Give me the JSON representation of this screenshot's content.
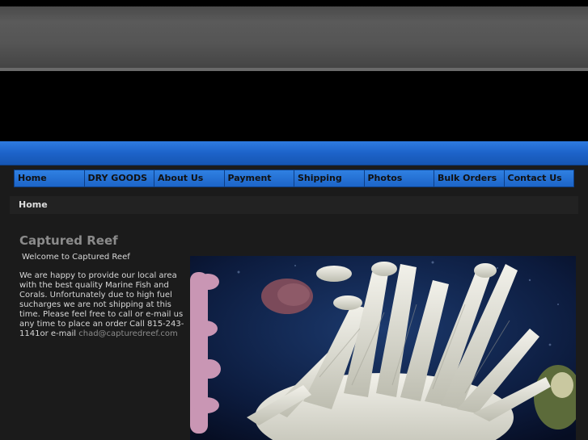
{
  "nav": {
    "items": [
      {
        "label": "Home"
      },
      {
        "label": "DRY GOODS"
      },
      {
        "label": "About Us"
      },
      {
        "label": "Payment"
      },
      {
        "label": "Shipping"
      },
      {
        "label": "Photos"
      },
      {
        "label": "Bulk Orders"
      },
      {
        "label": "Contact Us"
      }
    ]
  },
  "breadcrumb": "Home",
  "main": {
    "title": "Captured Reef",
    "welcome": "Welcome to Captured Reef",
    "body": "We are happy to provide our local area with the best quality Marine Fish and Corals. Unfortunately due to high fuel sucharges we are not shipping at this time. Please feel free to call or e-mail us any time to place an order Call 815-243-1141or e-mail",
    "email": "chad@capturedreef.com"
  },
  "colors": {
    "accent_blue": "#1f6fd1",
    "background": "#1b1b1b",
    "title_gray": "#8b8b8b"
  }
}
